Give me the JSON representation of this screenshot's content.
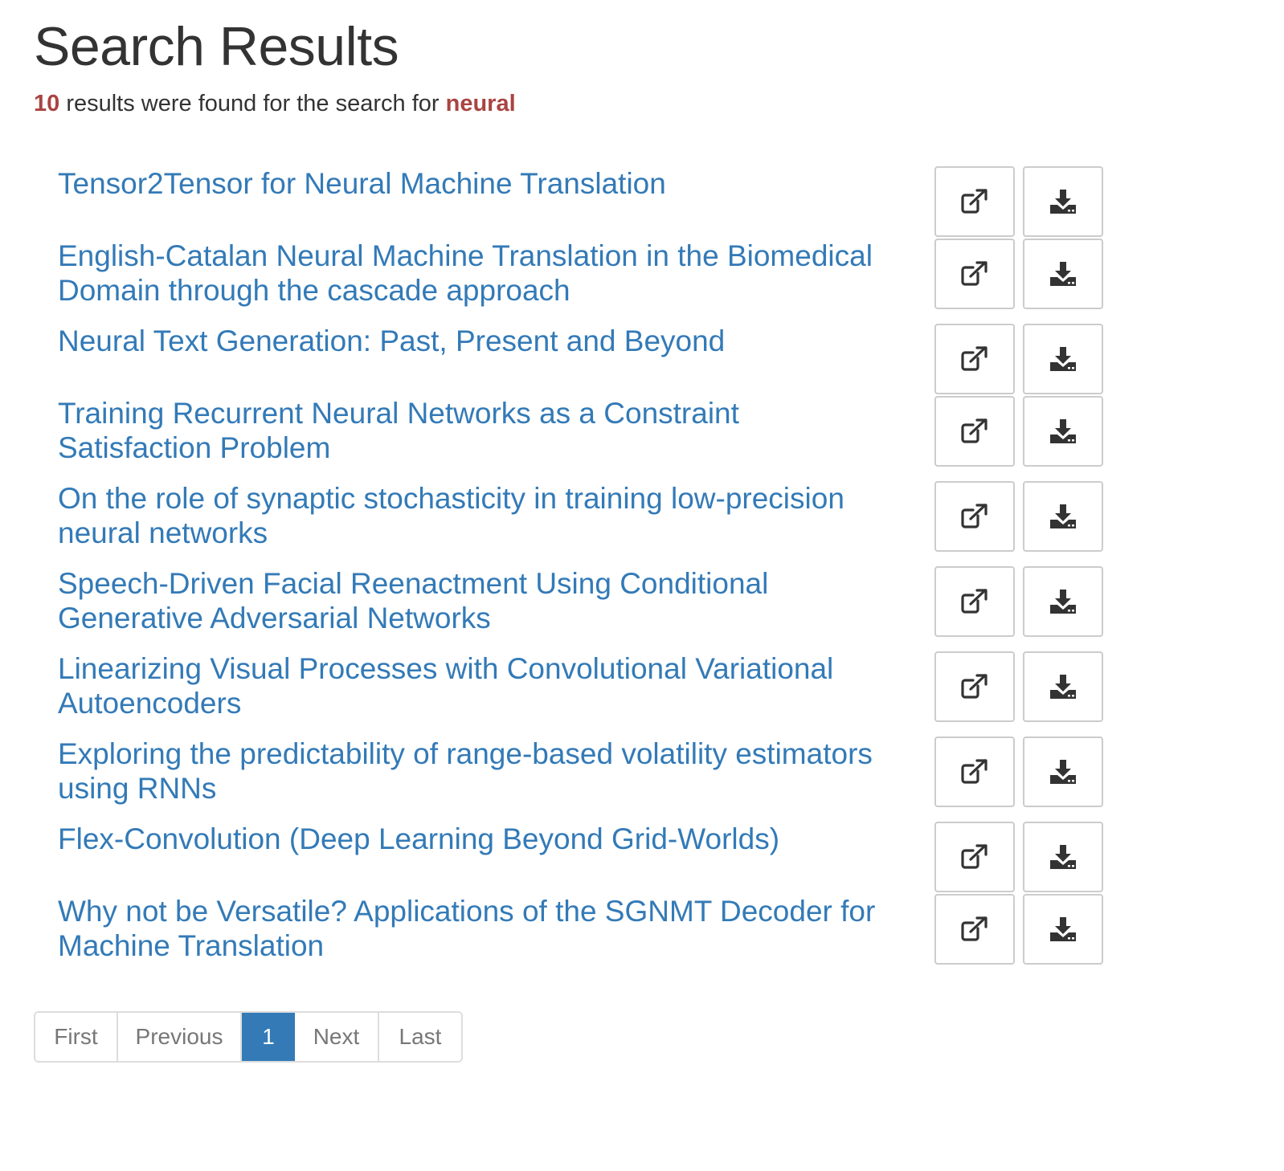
{
  "header": {
    "title": "Search Results"
  },
  "summary": {
    "count": "10",
    "text_mid": " results were found for the search for ",
    "query": "neural"
  },
  "results": [
    {
      "title": "Tensor2Tensor for Neural Machine Translation"
    },
    {
      "title": "English-Catalan Neural Machine Translation in the Biomedical Domain through the cascade approach"
    },
    {
      "title": "Neural Text Generation: Past, Present and Beyond"
    },
    {
      "title": "Training Recurrent Neural Networks as a Constraint Satisfaction Problem"
    },
    {
      "title": "On the role of synaptic stochasticity in training low-precision neural networks"
    },
    {
      "title": "Speech-Driven Facial Reenactment Using Conditional Generative Adversarial Networks"
    },
    {
      "title": "Linearizing Visual Processes with Convolutional Variational Autoencoders"
    },
    {
      "title": "Exploring the predictability of range-based volatility estimators using RNNs"
    },
    {
      "title": "Flex-Convolution (Deep Learning Beyond Grid-Worlds)"
    },
    {
      "title": "Why not be Versatile? Applications of the SGNMT Decoder for Machine Translation"
    }
  ],
  "row_buttons": {
    "open_icon": "external-link-icon",
    "download_icon": "download-icon"
  },
  "pagination": {
    "first": "First",
    "previous": "Previous",
    "current": "1",
    "next": "Next",
    "last": "Last"
  },
  "colors": {
    "link": "#337ab7",
    "highlight": "#a94442",
    "active_page": "#337ab7"
  }
}
